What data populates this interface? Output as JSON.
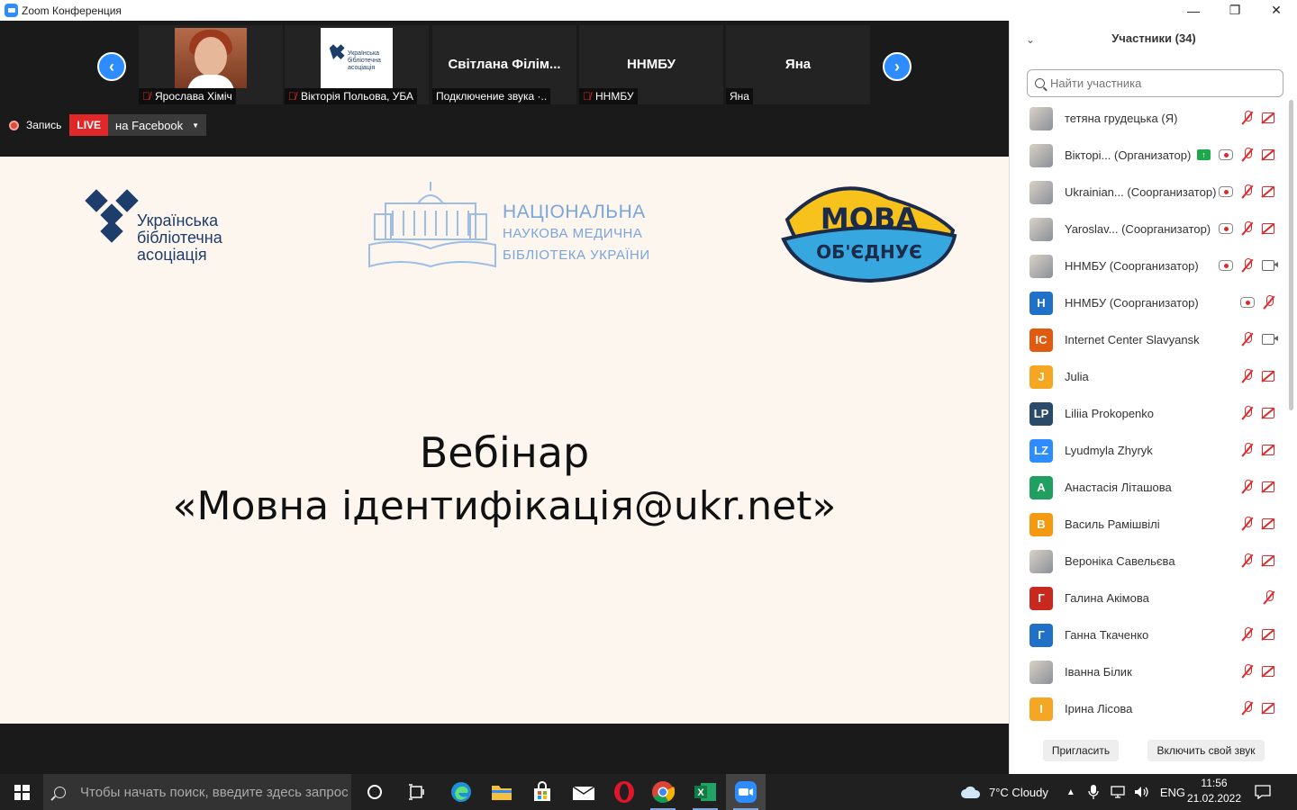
{
  "window": {
    "title": "Zoom Конференция",
    "controls": [
      "—",
      "❐",
      "✕"
    ]
  },
  "video_strip": {
    "tiles": [
      {
        "name": "Ярослава Хіміч",
        "muted": true
      },
      {
        "name": "Вікторія Польова, УБА",
        "muted": true
      },
      {
        "name": "Світлана Філім...",
        "label": "Подключение звука ·.."
      },
      {
        "name": "ННМБУ",
        "label": "ННМБУ",
        "muted": true
      },
      {
        "name": "Яна",
        "label": "Яна"
      }
    ],
    "uba_logo_lines": [
      "Українська",
      "бібліотечна",
      "асоціація"
    ]
  },
  "recording": {
    "record_label": "Запись",
    "live_label": "LIVE",
    "stream_target": "на Facebook"
  },
  "slide": {
    "uba_lines": [
      "Українська",
      "бібліотечна",
      "асоціація"
    ],
    "nnmb_lines": [
      "НАЦІОНАЛЬНА",
      "НАУКОВА МЕДИЧНА",
      "БІБЛІОТЕКА УКРАЇНИ"
    ],
    "mova_lines": [
      "МОВА",
      "ОБ'ЄДНУЄ"
    ],
    "title_line1": "Вебінар",
    "title_line2": "«Мовна ідентифікація@ukr.net»"
  },
  "participants": {
    "header": "Участники (34)",
    "search_placeholder": "Найти участника",
    "items": [
      {
        "name": "тетяна грудецька (Я)",
        "avatar": "img",
        "mic": "off",
        "cam": "off"
      },
      {
        "name": "Вікторі...  (Организатор)",
        "avatar": "img",
        "share": true,
        "rec": true,
        "mic": "off",
        "cam": "off"
      },
      {
        "name": "Ukrainian...  (Соорганизатор)",
        "avatar": "img",
        "rec": true,
        "mic": "off",
        "cam": "off"
      },
      {
        "name": "Yaroslav...  (Соорганизатор)",
        "avatar": "img",
        "rec": true,
        "mic": "off",
        "cam": "off"
      },
      {
        "name": "ННМБУ (Соорганизатор)",
        "avatar": "img",
        "rec": true,
        "mic": "off",
        "cam": "on"
      },
      {
        "name": "ННМБУ (Соорганизатор)",
        "initials": "Н",
        "color": "#2170c8",
        "rec": true,
        "mic": "off",
        "cam": "none",
        "rec_shift": true
      },
      {
        "name": "Internet Center Slavyansk",
        "initials": "IC",
        "color": "#e05a10",
        "mic": "off",
        "cam": "on"
      },
      {
        "name": "Julia",
        "initials": "J",
        "color": "#f5a623",
        "mic": "off",
        "cam": "off"
      },
      {
        "name": "Liliia Prokopenko",
        "initials": "LP",
        "color": "#2a4a6a",
        "mic": "off",
        "cam": "off"
      },
      {
        "name": "Lyudmyla Zhyryk",
        "initials": "LZ",
        "color": "#2d8cff",
        "mic": "off",
        "cam": "off"
      },
      {
        "name": "Анастасія Літашова",
        "initials": "А",
        "color": "#20a060",
        "mic": "off",
        "cam": "off"
      },
      {
        "name": "Василь Рамішвілі",
        "initials": "В",
        "color": "#f59a10",
        "mic": "off",
        "cam": "off"
      },
      {
        "name": "Вероніка Савельєва",
        "avatar": "img",
        "mic": "off",
        "cam": "off"
      },
      {
        "name": "Галина  Акімова",
        "initials": "Г",
        "color": "#c8281e",
        "mic": "off",
        "cam": "none",
        "mic_shift": true
      },
      {
        "name": "Ганна Ткаченко",
        "initials": "Г",
        "color": "#2170c8",
        "mic": "off",
        "cam": "off"
      },
      {
        "name": "Іванна Білик",
        "avatar": "img",
        "mic": "off",
        "cam": "off"
      },
      {
        "name": "Ірина Лісова",
        "initials": "І",
        "color": "#f5a623",
        "mic": "off",
        "cam": "off"
      }
    ],
    "invite_label": "Пригласить",
    "unmute_label": "Включить свой звук"
  },
  "taskbar": {
    "search_placeholder": "Чтобы начать поиск, введите здесь запрос",
    "weather": "7°C  Cloudy",
    "lang": "ENG",
    "time": "11:56",
    "date": "21.02.2022"
  },
  "colors": {
    "accent": "#2d8cff",
    "live": "#e02828",
    "slide_bg": "#fdf6ee",
    "uba_blue": "#1d3d6b",
    "nnmb_blue": "#7aa6d9"
  }
}
